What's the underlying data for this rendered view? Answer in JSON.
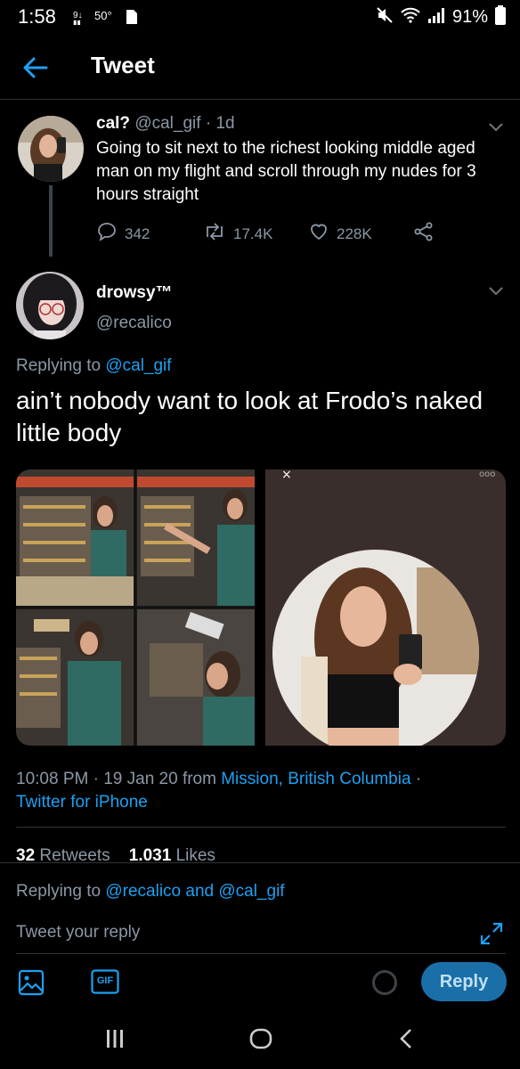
{
  "status_bar": {
    "time": "1:58",
    "temperature": "50°",
    "battery": "91%",
    "icons": [
      "signal-alt-icon",
      "sim-icon",
      "mute-icon",
      "wifi-icon",
      "signal-bars-icon",
      "battery-icon"
    ]
  },
  "header": {
    "title": "Tweet"
  },
  "parent_tweet": {
    "name": "cal?",
    "handle": "@cal_gif",
    "age": "· 1d",
    "text": "Going to sit next to the richest looking middle aged man on my flight and scroll through my nudes for 3 hours straight",
    "replies": "342",
    "retweets": "17.4K",
    "likes": "228K"
  },
  "reply_tweet": {
    "name": "drowsy™",
    "handle": "@recalico",
    "replying_prefix": "Replying to",
    "replying_to": "@cal_gif",
    "text": "ain’t nobody want to look at Frodo’s naked little body",
    "time_date": "10:08 PM · 19 Jan 20 from",
    "location": "Mission, British Columbia",
    "sep": "·",
    "client": "Twitter for iPhone",
    "retweets_count": "32",
    "retweets_label": "Retweets",
    "likes_count": "1.031",
    "likes_label": "Likes"
  },
  "composer": {
    "replying_prefix": "Replying to",
    "replying_to": "@recalico and @cal_gif",
    "placeholder": "Tweet your reply",
    "reply_button": "Reply",
    "gif_label": "GIF"
  },
  "colors": {
    "accent": "#1da1f2",
    "background": "#000000",
    "muted": "#8b98a5"
  }
}
